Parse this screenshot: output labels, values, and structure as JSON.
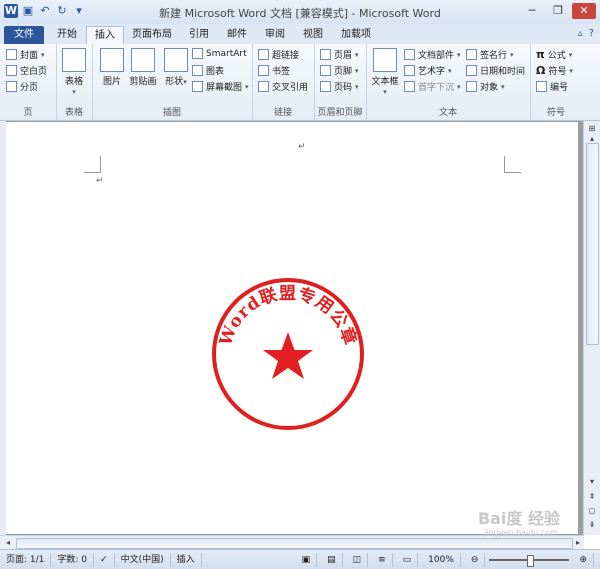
{
  "window": {
    "title": "新建 Microsoft Word 文档 [兼容模式] - Microsoft Word"
  },
  "quick_access": {
    "icons": [
      "word-logo-icon",
      "save-icon",
      "undo-icon",
      "redo-icon",
      "customize-icon"
    ]
  },
  "window_buttons": {
    "minimize": "─",
    "restore": "❐",
    "close": "✕"
  },
  "tabs": [
    "文件",
    "开始",
    "插入",
    "页面布局",
    "引用",
    "邮件",
    "审阅",
    "视图",
    "加载项"
  ],
  "active_tab": "插入",
  "ribbon": {
    "pages": {
      "label": "页",
      "items": [
        "封面",
        "空白页",
        "分页"
      ]
    },
    "tables": {
      "label": "表格",
      "items": [
        "表格"
      ]
    },
    "illustrations": {
      "label": "插图",
      "items": [
        "图片",
        "剪贴画",
        "形状",
        "SmartArt",
        "图表",
        "屏幕截图"
      ]
    },
    "links": {
      "label": "链接",
      "items": [
        "超链接",
        "书签",
        "交叉引用"
      ]
    },
    "header_footer": {
      "label": "页眉和页脚",
      "items": [
        "页眉",
        "页脚",
        "页码"
      ]
    },
    "text": {
      "label": "文本",
      "items": [
        "文本框",
        "文档部件",
        "艺术字",
        "首字下沉",
        "签名行",
        "日期和时间",
        "对象"
      ]
    },
    "symbols": {
      "label": "符号",
      "items": [
        "公式",
        "符号",
        "编号"
      ]
    }
  },
  "document": {
    "paragraph_mark": "↵",
    "stamp": {
      "text": "Word联盟专用公章",
      "color": "#e02020"
    }
  },
  "watermark": {
    "text": "Bai度 经验",
    "sub": "jingyan.baidu.com"
  },
  "statusbar": {
    "page": "页面: 1/1",
    "words": "字数: 0",
    "language": "中文(中国)",
    "mode": "插入",
    "zoom": "100%"
  }
}
